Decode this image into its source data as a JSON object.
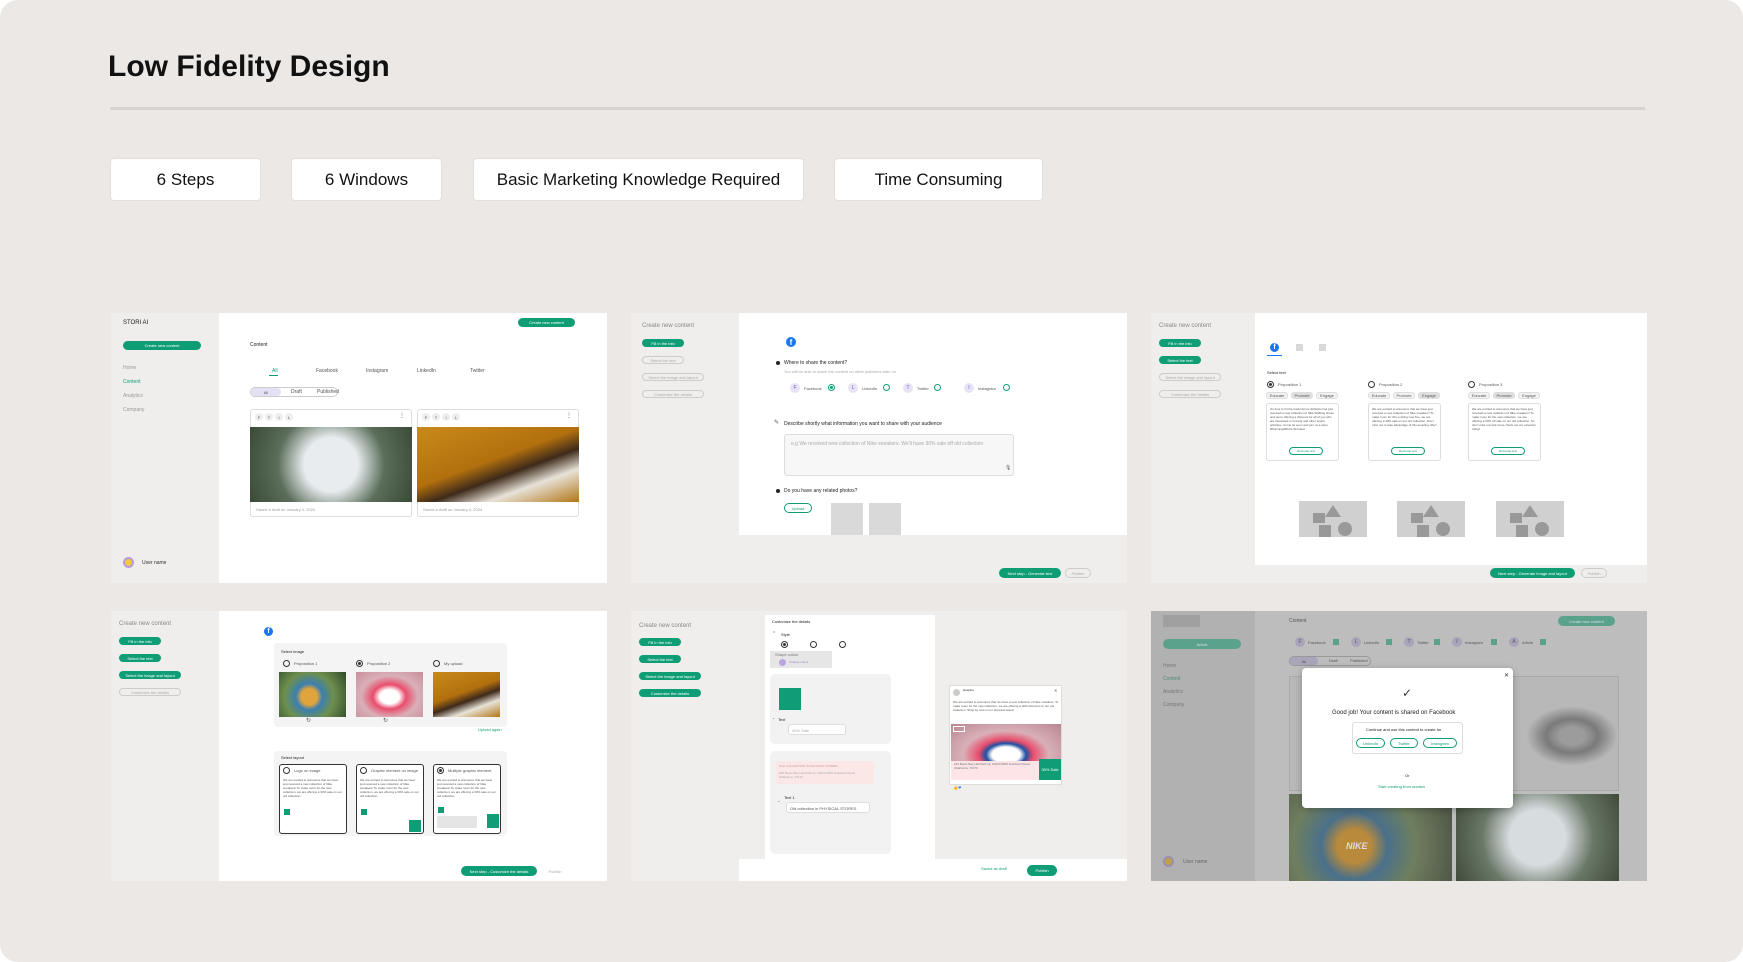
{
  "page": {
    "title": "Low Fidelity Design",
    "tags": [
      "6 Steps",
      "6 Windows",
      "Basic Marketing Knowledge Required",
      "Time Consuming"
    ]
  },
  "colors": {
    "background": "#ebe8e6",
    "accent": "#0f9d76",
    "facebook": "#1877f2"
  },
  "frame1": {
    "brand": "STORI AI",
    "create_button": "Create new content",
    "nav": [
      "Home",
      "Content",
      "Analytics",
      "Company"
    ],
    "heading": "Content",
    "top_button": "Create new content",
    "tabs": [
      "All",
      "Facebook",
      "Instagram",
      "LinkedIn",
      "Twitter"
    ],
    "filters": [
      "All",
      "Draft",
      "Published"
    ],
    "channel_letters": [
      "F",
      "T",
      "I",
      "L"
    ],
    "card_meta": [
      "Saved a draft on January 4, 2024",
      "Saved a draft on January 4, 2024"
    ],
    "user": "User name"
  },
  "frame2": {
    "heading": "Create new content",
    "steps": [
      "Fill in the info",
      "Select the text",
      "Select the image and layout",
      "Customize the details"
    ],
    "q1": "Where to share the content?",
    "q1_sub": "You will be able to share the content on other platforms later on",
    "platforms": [
      "Facebook",
      "LinkedIn",
      "Twitter",
      "Instagram"
    ],
    "platform_letters": [
      "F",
      "L",
      "T",
      "I"
    ],
    "q2": "Describe shortly what information you want to share with your audience",
    "placeholder": "e.g We received new collection of Nike sneakers. We'll have 30% sale off old collection",
    "q3": "Do you have any related photos?",
    "upload": "Upload",
    "next": "Next step - Generate text",
    "publish": "Publish"
  },
  "frame3": {
    "heading": "Create new content",
    "steps": [
      "Fill in the info",
      "Select the text",
      "Select the image and layout",
      "Customize the details"
    ],
    "section": "Select text",
    "propositions": [
      "Proposition 1",
      "Proposition 2",
      "Proposition 3"
    ],
    "modes": [
      "Educate",
      "Promote",
      "Engage"
    ],
    "texts": [
      "It's time to hit the track! Armor Athletics has just received a new collection of Nike Walking shoes and we're offering a discount for all of you who are interested in running and other sports activities. Come as soon and join us a store. #RunningWithUs #Limited",
      "We are excited to announce that we have just received a new collection of Nike sneakers! To make room for this exciting new line, we are offering a 30% sale on our old collection. Don't miss out to take advantage of this amazing offer!",
      "We are excited to announce that we have just received a new collection of Nike sneakers! To make room for the new collection, we are offering a 30% off sale on our old collection. So don't miss out and come check out our selection today!"
    ],
    "regenerate": "Recreate text",
    "next": "Next step - Generate image and layout",
    "publish": "Publish"
  },
  "frame4": {
    "heading": "Create new content",
    "steps": [
      "Fill in the info",
      "Select the text",
      "Select the image and layout",
      "Customize the details"
    ],
    "select_image": "Select image",
    "image_options": [
      "Proposition 1",
      "Proposition 2",
      "My upload"
    ],
    "upload_again": "Upload again",
    "select_layout": "Select layout",
    "layouts": [
      "Logo on image",
      "Graphic element on image",
      "Multiple graphic element"
    ],
    "layout_text": "We are excited to announce that we have just received a new collection of Nike sneakers! To make room for the new collection, we are offering a 30% sale on our old collection.",
    "next": "Next step - Customize the details",
    "publish": "Publish"
  },
  "frame5": {
    "heading": "Create new content",
    "steps": [
      "Fill in the info",
      "Select the text",
      "Select the image and layout",
      "Customize the details"
    ],
    "panel_title": "Customize the details",
    "style": "Style",
    "shape": "Shape colour",
    "change_colour": "Change colour",
    "text_label": "Text",
    "sale_text": "30% Sale",
    "text1_label": "Text 1",
    "text1_value": "Old collection in PHYSICAL STORES",
    "banner": "OLD COLLECTION IN PHYSICAL STORES",
    "address": "222 Boots Bay Hall Park Gl, 10020 8309 Guildman Road, Oklahoma, 73170",
    "post_name": "Hesplus",
    "post_text": "We are excited to announce that we have a new collection of Nike sneakers. To make room for the new collection, we are offering a 30% discount on our old collection. Shop by now in our physical stores!",
    "sale_badge": "30% Sale",
    "save_draft": "Saved as draft",
    "publish": "Publish"
  },
  "frame6": {
    "create_button": "Create new content",
    "side_button": "Article",
    "nav": [
      "Home",
      "Content",
      "Analytics",
      "Company"
    ],
    "platforms": [
      "Facebook",
      "LinkedIn",
      "Twitter",
      "Instagram",
      "Article"
    ],
    "platform_letters": [
      "F",
      "L",
      "T",
      "I",
      "A"
    ],
    "filters": [
      "All",
      "Draft",
      "Published"
    ],
    "modal_title": "Good job! Your content is shared on Facebook",
    "modal_sub": "Continue and use this content to create for",
    "modal_options": [
      "LinkedIn",
      "Twitter",
      "Instagram"
    ],
    "or": "Or",
    "scratch": "Start creating from scratch",
    "user": "User name",
    "shoe_brand": "NIKE"
  }
}
